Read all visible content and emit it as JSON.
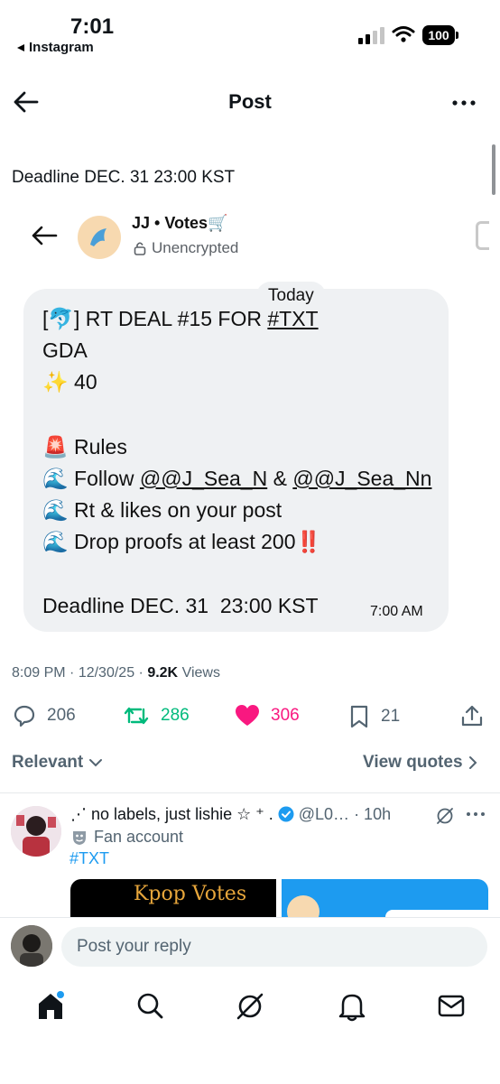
{
  "status_bar": {
    "time": "7:01",
    "back_app": "Instagram",
    "battery": "100"
  },
  "nav": {
    "title": "Post"
  },
  "post": {
    "top_text": "Deadline DEC. 31  23:00 KST",
    "embedded": {
      "chat_name": "JJ • Votes🛒",
      "encryption": "Unencrypted",
      "date_chip": "Today",
      "lines": {
        "l1_prefix": "[🐬] RT DEAL #15 FOR ",
        "l1_tag": "#TXT",
        "l2": "GDA",
        "l3": "✨ 40",
        "l5": "🚨 Rules",
        "l6_prefix": "🌊 Follow ",
        "l6_user1": "@@J_Sea_N",
        "l6_mid": " & ",
        "l6_user2": "@@J_Sea_Nn",
        "l7": "🌊 Rt & likes on your post",
        "l8_text": "🌊 Drop proofs at least 200",
        "l8_emoji": "‼️",
        "l10": "Deadline DEC. 31  23:00 KST"
      },
      "message_time": "7:00 AM"
    },
    "meta": {
      "time": "8:09 PM",
      "date": "12/30/25",
      "views_count": "9.2K",
      "views_label": "Views"
    },
    "actions": {
      "replies": "206",
      "reposts": "286",
      "likes": "306",
      "bookmarks": "21"
    },
    "sort_label": "Relevant",
    "view_quotes": "View quotes"
  },
  "reply": {
    "name": "⋰ no labels, just lishie ☆ ⁺ . ",
    "handle": "@L0…",
    "age": "· 10h",
    "badge": "Fan account",
    "tag": "#TXT",
    "media_text": "Kpop Votes"
  },
  "composer": {
    "placeholder": "Post your reply"
  },
  "colors": {
    "like": "#f91880",
    "repost": "#00ba7c",
    "link": "#1d9bf0",
    "verified": "#1d9bf0"
  }
}
